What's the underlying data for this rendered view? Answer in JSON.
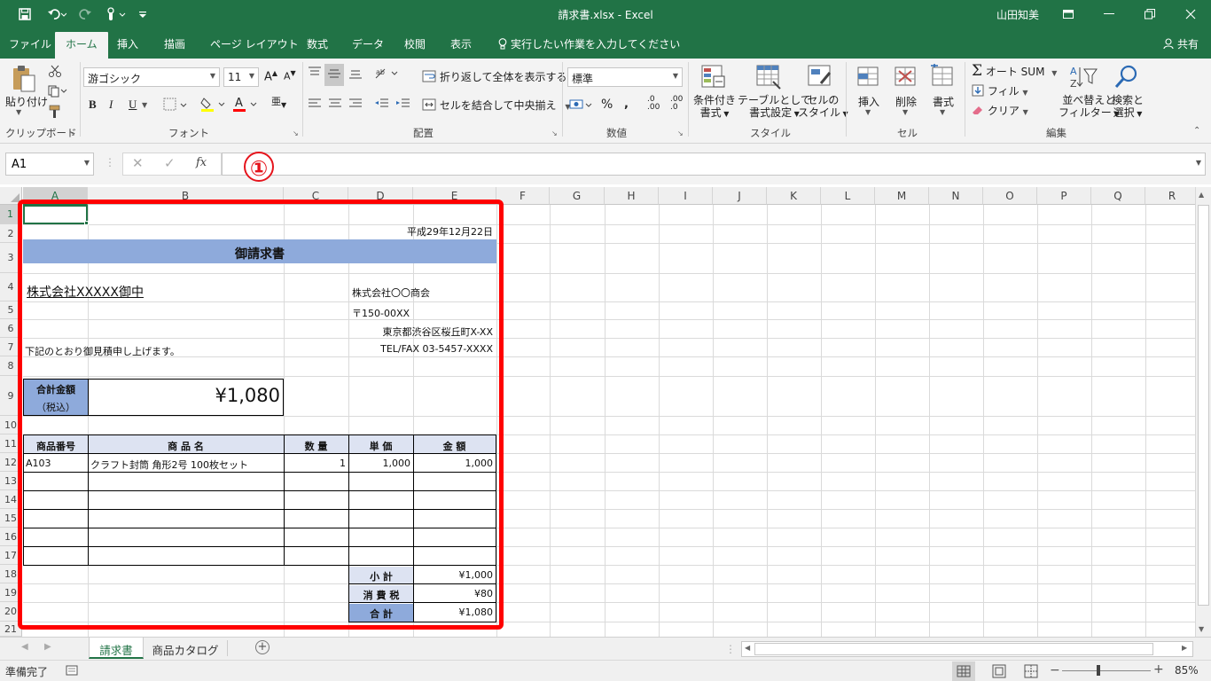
{
  "titlebar": {
    "doc_title": "請求書.xlsx - Excel",
    "user_name": "山田知美"
  },
  "menu": {
    "tabs": [
      "ファイル",
      "ホーム",
      "挿入",
      "描画",
      "ページ レイアウト",
      "数式",
      "データ",
      "校閲",
      "表示"
    ],
    "tell_me": "実行したい作業を入力してください",
    "share": "共有"
  },
  "ribbon": {
    "clipboard": {
      "paste": "貼り付け",
      "label": "クリップボード"
    },
    "font": {
      "family": "游ゴシック",
      "size": "11",
      "bold": "B",
      "italic": "I",
      "underline": "U",
      "label": "フォント"
    },
    "alignment": {
      "wrap": "折り返して全体を表示する",
      "merge": "セルを結合して中央揃え",
      "label": "配置"
    },
    "number": {
      "format": "標準",
      "label": "数値"
    },
    "styles": {
      "conditional_1": "条件付き",
      "conditional_2": "書式",
      "table_1": "テーブルとして",
      "table_2": "書式設定",
      "cell_1": "セルの",
      "cell_2": "スタイル",
      "label": "スタイル"
    },
    "cells": {
      "insert": "挿入",
      "delete": "削除",
      "format": "書式",
      "label": "セル"
    },
    "editing": {
      "autosum": "オート SUM",
      "fill": "フィル",
      "clear": "クリア",
      "sort_1": "並べ替えと",
      "sort_2": "フィルター",
      "find_1": "検索と",
      "find_2": "選択",
      "label": "編集"
    }
  },
  "formula_bar": {
    "name_box": "A1",
    "fx": "fx",
    "step_marker": "①"
  },
  "columns": [
    "A",
    "B",
    "C",
    "D",
    "E",
    "F",
    "G",
    "H",
    "I",
    "J",
    "K",
    "L",
    "M",
    "N",
    "O",
    "P",
    "Q",
    "R"
  ],
  "rows": [
    "1",
    "2",
    "3",
    "4",
    "5",
    "6",
    "7",
    "8",
    "9",
    "10",
    "11",
    "12",
    "13",
    "14",
    "15",
    "16",
    "17",
    "18",
    "19",
    "20",
    "21"
  ],
  "invoice": {
    "date": "平成29年12月22日",
    "title": "御請求書",
    "client": "株式会社XXXXX御中",
    "company": "株式会社〇〇商会",
    "postal": "〒150-00XX",
    "address": "東京都渋谷区桜丘町X-XX",
    "tel": "TEL/FAX 03-5457-XXXX",
    "note": "下記のとおり御見積申し上げます。",
    "total_label_1": "合計金額",
    "total_label_2": "（税込）",
    "total_value": "¥1,080",
    "headers": [
      "商品番号",
      "商 品 名",
      "数 量",
      "単 価",
      "金 額"
    ],
    "item": {
      "code": "A103",
      "name": "クラフト封筒 角形2号 100枚セット",
      "qty": "1",
      "price": "1,000",
      "amount": "1,000"
    },
    "subtotal_label": "小 計",
    "subtotal_value": "¥1,000",
    "tax_label": "消 費 税",
    "tax_value": "¥80",
    "grand_label": "合 計",
    "grand_value": "¥1,080"
  },
  "sheets": {
    "active": "請求書",
    "other": "商品カタログ"
  },
  "status": {
    "ready": "準備完了",
    "zoom": "85%"
  },
  "colors": {
    "excel_green": "#217346",
    "title_band": "#8eaadb",
    "total_label_fill": "#8eaadb",
    "header_fill": "#dde3f2",
    "highlight_red": "#ff0000"
  }
}
